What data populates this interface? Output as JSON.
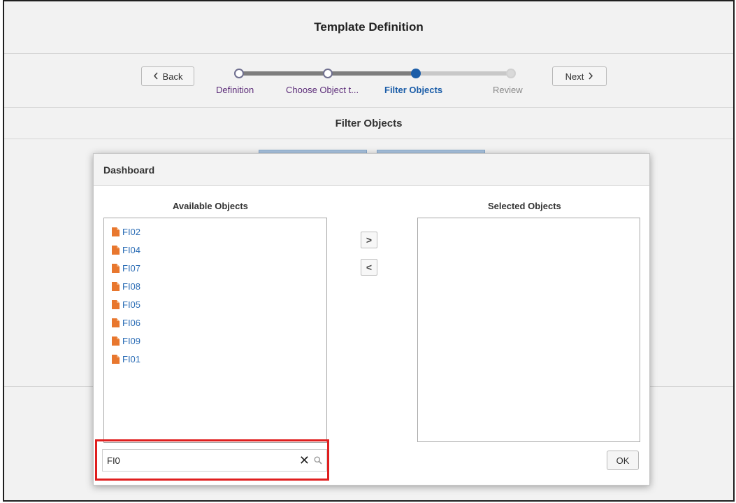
{
  "page": {
    "title": "Template Definition"
  },
  "train": {
    "back_label": "Back",
    "next_label": "Next",
    "steps": [
      {
        "label": "Definition",
        "state": "visited"
      },
      {
        "label": "Choose Object t...",
        "state": "visited"
      },
      {
        "label": "Filter Objects",
        "state": "current"
      },
      {
        "label": "Review",
        "state": "future"
      }
    ]
  },
  "section": {
    "title": "Filter Objects"
  },
  "dialog": {
    "title": "Dashboard",
    "available_title": "Available Objects",
    "selected_title": "Selected Objects",
    "available_items": [
      "FI02",
      "FI04",
      "FI07",
      "FI08",
      "FI05",
      "FI06",
      "FI09",
      "FI01"
    ],
    "selected_items": [],
    "move_right_symbol": ">",
    "move_left_symbol": "<",
    "search": {
      "value": "FI0",
      "placeholder": ""
    },
    "ok_label": "OK"
  },
  "colors": {
    "accent": "#1b5da8",
    "visited_label": "#5d2e7a",
    "link": "#2a6cb5",
    "file_icon": "#e8772e",
    "highlight": "#e01e1e"
  },
  "icons": {
    "back": "chevron-left-icon",
    "next": "chevron-right-icon",
    "item": "document-icon",
    "clear": "close-icon",
    "search": "search-icon"
  }
}
